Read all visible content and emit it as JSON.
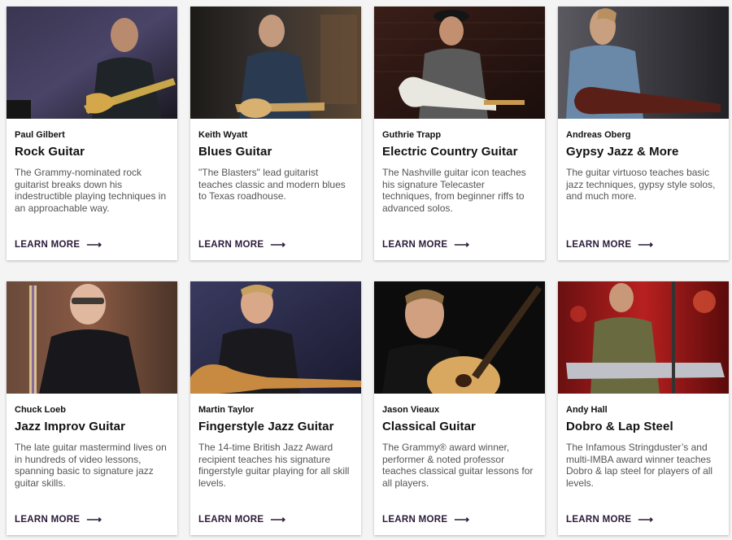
{
  "cards": [
    {
      "instructor": "Paul Gilbert",
      "course": "Rock Guitar",
      "description": "The Grammy-nominated rock guitarist breaks down his indestructible playing techniques in an approachable way.",
      "cta": "LEARN MORE",
      "icon": "arrow-right-icon"
    },
    {
      "instructor": "Keith Wyatt",
      "course": "Blues Guitar",
      "description": "\"The Blasters\" lead guitarist teaches classic and modern blues to Texas roadhouse.",
      "cta": "LEARN MORE",
      "icon": "arrow-right-icon"
    },
    {
      "instructor": "Guthrie Trapp",
      "course": "Electric Country Guitar",
      "description": "The Nashville guitar icon teaches his signature Telecaster techniques, from beginner riffs to advanced solos.",
      "cta": "LEARN MORE",
      "icon": "arrow-right-icon"
    },
    {
      "instructor": "Andreas Oberg",
      "course": "Gypsy Jazz & More",
      "description": "The guitar virtuoso teaches basic jazz techniques, gypsy style solos, and much more.",
      "cta": "LEARN MORE",
      "icon": "arrow-right-icon"
    },
    {
      "instructor": "Chuck Loeb",
      "course": "Jazz Improv Guitar",
      "description": "The late guitar mastermind lives on in hundreds of video lessons, spanning basic to signature jazz guitar skills.",
      "cta": "LEARN MORE",
      "icon": "arrow-right-icon"
    },
    {
      "instructor": "Martin Taylor",
      "course": "Fingerstyle Jazz Guitar",
      "description": "The 14-time British Jazz Award recipient teaches his signature fingerstyle guitar playing for all skill levels.",
      "cta": "LEARN MORE",
      "icon": "arrow-right-icon"
    },
    {
      "instructor": "Jason Vieaux",
      "course": "Classical Guitar",
      "description": "The Grammy® award winner, performer & noted professor teaches classical guitar lessons for all players.",
      "cta": "LEARN MORE",
      "icon": "arrow-right-icon"
    },
    {
      "instructor": "Andy Hall",
      "course": "Dobro & Lap Steel",
      "description": "The Infamous Stringduster’s and multi-IMBA award winner teaches Dobro & lap steel for players of all levels.",
      "cta": "LEARN MORE",
      "icon": "arrow-right-icon"
    }
  ],
  "colors": {
    "cta": "#2b1a38",
    "card_bg": "#ffffff",
    "page_bg": "#f4f4f4"
  }
}
